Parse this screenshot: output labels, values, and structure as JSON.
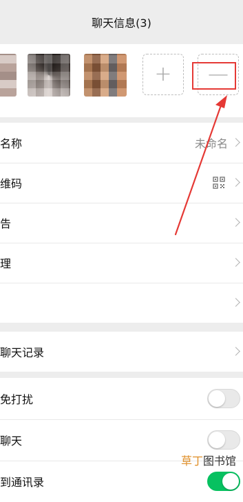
{
  "header": {
    "title": "聊天信息(3)"
  },
  "members": {
    "add_symbol": "+",
    "remove_symbol": "—"
  },
  "settings": {
    "group_name": {
      "label": "名称",
      "value": "未命名"
    },
    "qr_code": {
      "label": "维码"
    },
    "notice": {
      "label": "告"
    },
    "manage": {
      "label": "理"
    },
    "remark": {
      "label": ""
    },
    "search_history": {
      "label": "聊天记录"
    },
    "mute": {
      "label": "免打扰",
      "on": false
    },
    "pin": {
      "label": "聊天",
      "on": false
    },
    "save_contacts": {
      "label": "到通讯录",
      "on": true
    }
  },
  "watermark": {
    "part1": "草丁",
    "part2": "图书馆"
  },
  "colors": {
    "accent_green": "#07c160",
    "annotation_red": "#e53935"
  }
}
